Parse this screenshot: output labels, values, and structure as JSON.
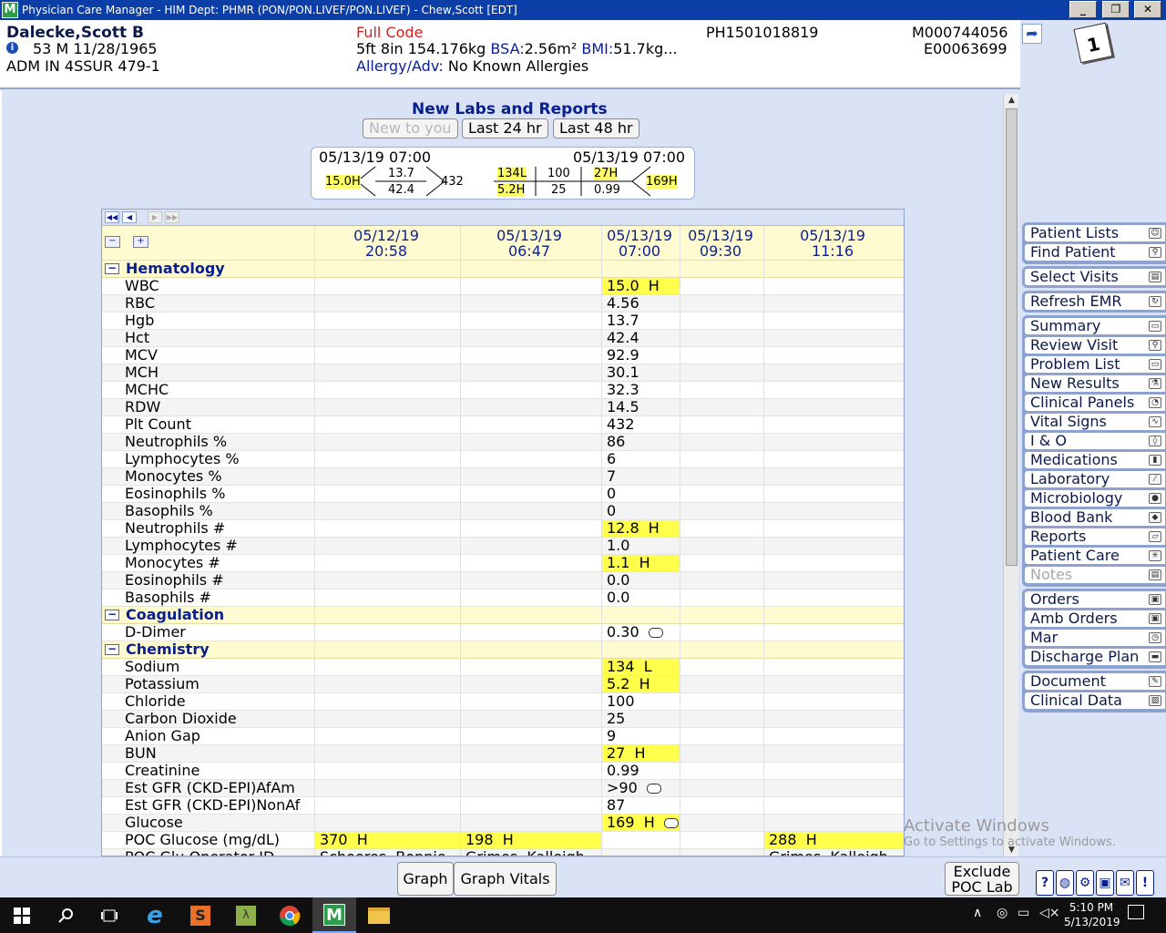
{
  "window": {
    "title": "Physician Care Manager - HIM Dept: PHMR (PON/PON.LIVEF/PON.LIVEF) - Chew,Scott [EDT]",
    "logo": "M",
    "minimize": "_",
    "restore": "❐",
    "close": "✕"
  },
  "patient": {
    "name": "Dalecke,Scott B",
    "age_sex_dob": "53  M  11/28/1965",
    "location": "ADM IN   4SSUR   479-1",
    "code_status": "Full Code",
    "measurements": "5ft 8in  154.176kg",
    "bsa_label": "BSA:",
    "bsa_value": "2.56m²",
    "bmi_label": "BMI:",
    "bmi_value": "51.7kg...",
    "allergy_label": "Allergy/Adv:",
    "allergy_value": "No Known Allergies",
    "account": "PH1501018819",
    "mrn": "M000744056",
    "encounter": "E00063699"
  },
  "sidebar": {
    "group1": [
      {
        "label": "Patient Lists",
        "icon": "people-icon"
      },
      {
        "label": "Find Patient",
        "icon": "search-people-icon"
      }
    ],
    "group2": [
      {
        "label": "Select Visits",
        "icon": "visits-icon"
      }
    ],
    "group3": [
      {
        "label": "Refresh EMR",
        "icon": "refresh-icon"
      }
    ],
    "group4": [
      {
        "label": "Summary",
        "icon": "folder-icon"
      },
      {
        "label": "Review Visit",
        "icon": "review-icon"
      },
      {
        "label": "Problem List",
        "icon": "folder-icon"
      },
      {
        "label": "New Results",
        "icon": "flask-icon"
      },
      {
        "label": "Clinical Panels",
        "icon": "panels-icon"
      },
      {
        "label": "Vital Signs",
        "icon": "pulse-icon"
      },
      {
        "label": "I & O",
        "icon": "drop-icon"
      },
      {
        "label": "Medications",
        "icon": "pill-bottle-icon"
      },
      {
        "label": "Laboratory",
        "icon": "test-tube-icon"
      },
      {
        "label": "Microbiology",
        "icon": "petri-dish-icon"
      },
      {
        "label": "Blood Bank",
        "icon": "blood-icon"
      },
      {
        "label": "Reports",
        "icon": "report-icon"
      },
      {
        "label": "Patient Care",
        "icon": "patient-care-icon"
      },
      {
        "label": "Notes",
        "icon": "notes-icon"
      }
    ],
    "group5": [
      {
        "label": "Orders",
        "icon": "orders-icon"
      },
      {
        "label": "Amb Orders",
        "icon": "amb-orders-icon"
      },
      {
        "label": "Mar",
        "icon": "mar-icon"
      },
      {
        "label": "Discharge Plan",
        "icon": "car-icon"
      }
    ],
    "group6": [
      {
        "label": "Document",
        "icon": "pen-icon"
      },
      {
        "label": "Clinical Data",
        "icon": "clinical-data-icon"
      }
    ]
  },
  "labs": {
    "title": "New Labs and Reports",
    "tabs": [
      "New to you",
      "Last 24 hr",
      "Last 48 hr"
    ],
    "fishbone": {
      "cbc_time": "05/13/19 07:00",
      "wbc": "15.0H",
      "hgb": "13.7",
      "hct": "42.4",
      "plt": "432",
      "bmp_time": "05/13/19 07:00",
      "na": "134L",
      "cl": "100",
      "bun": "27H",
      "k": "5.2H",
      "co2": "25",
      "cr": "0.99",
      "glu": "169H"
    },
    "columns": [
      {
        "date": "05/12/19",
        "time": "20:58"
      },
      {
        "date": "05/13/19",
        "time": "06:47"
      },
      {
        "date": "05/13/19",
        "time": "07:00"
      },
      {
        "date": "05/13/19",
        "time": "09:30"
      },
      {
        "date": "05/13/19",
        "time": "11:16"
      }
    ],
    "rows": [
      {
        "type": "section",
        "name": "Hematology",
        "toggle": "−"
      },
      {
        "name": "WBC",
        "vals": [
          "",
          "",
          "15.0  H",
          "",
          ""
        ],
        "hi": [
          2
        ]
      },
      {
        "name": "RBC",
        "vals": [
          "",
          "",
          "4.56",
          "",
          ""
        ]
      },
      {
        "name": "Hgb",
        "vals": [
          "",
          "",
          "13.7",
          "",
          ""
        ]
      },
      {
        "name": "Hct",
        "vals": [
          "",
          "",
          "42.4",
          "",
          ""
        ]
      },
      {
        "name": "MCV",
        "vals": [
          "",
          "",
          "92.9",
          "",
          ""
        ]
      },
      {
        "name": "MCH",
        "vals": [
          "",
          "",
          "30.1",
          "",
          ""
        ]
      },
      {
        "name": "MCHC",
        "vals": [
          "",
          "",
          "32.3",
          "",
          ""
        ]
      },
      {
        "name": "RDW",
        "vals": [
          "",
          "",
          "14.5",
          "",
          ""
        ]
      },
      {
        "name": "Plt Count",
        "vals": [
          "",
          "",
          "432",
          "",
          ""
        ]
      },
      {
        "name": "Neutrophils %",
        "vals": [
          "",
          "",
          "86",
          "",
          ""
        ]
      },
      {
        "name": "Lymphocytes %",
        "vals": [
          "",
          "",
          "6",
          "",
          ""
        ]
      },
      {
        "name": "Monocytes %",
        "vals": [
          "",
          "",
          "7",
          "",
          ""
        ]
      },
      {
        "name": "Eosinophils %",
        "vals": [
          "",
          "",
          "0",
          "",
          ""
        ]
      },
      {
        "name": "Basophils %",
        "vals": [
          "",
          "",
          "0",
          "",
          ""
        ]
      },
      {
        "name": "Neutrophils #",
        "vals": [
          "",
          "",
          "12.8  H",
          "",
          ""
        ],
        "hi": [
          2
        ]
      },
      {
        "name": "Lymphocytes #",
        "vals": [
          "",
          "",
          "1.0",
          "",
          ""
        ]
      },
      {
        "name": "Monocytes #",
        "vals": [
          "",
          "",
          "1.1  H",
          "",
          ""
        ],
        "hi": [
          2
        ]
      },
      {
        "name": "Eosinophils #",
        "vals": [
          "",
          "",
          "0.0",
          "",
          ""
        ]
      },
      {
        "name": "Basophils #",
        "vals": [
          "",
          "",
          "0.0",
          "",
          ""
        ]
      },
      {
        "type": "section",
        "name": "Coagulation",
        "toggle": "−"
      },
      {
        "name": "D-Dimer",
        "vals": [
          "",
          "",
          "0.30",
          "",
          ""
        ],
        "cmt": [
          2
        ]
      },
      {
        "type": "section",
        "name": "Chemistry",
        "toggle": "−"
      },
      {
        "name": "Sodium",
        "vals": [
          "",
          "",
          "134  L",
          "",
          ""
        ],
        "hi": [
          2
        ]
      },
      {
        "name": "Potassium",
        "vals": [
          "",
          "",
          "5.2  H",
          "",
          ""
        ],
        "hi": [
          2
        ]
      },
      {
        "name": "Chloride",
        "vals": [
          "",
          "",
          "100",
          "",
          ""
        ]
      },
      {
        "name": "Carbon Dioxide",
        "vals": [
          "",
          "",
          "25",
          "",
          ""
        ]
      },
      {
        "name": "Anion Gap",
        "vals": [
          "",
          "",
          "9",
          "",
          ""
        ]
      },
      {
        "name": "BUN",
        "vals": [
          "",
          "",
          "27  H",
          "",
          ""
        ],
        "hi": [
          2
        ]
      },
      {
        "name": "Creatinine",
        "vals": [
          "",
          "",
          "0.99",
          "",
          ""
        ]
      },
      {
        "name": "Est GFR (CKD-EPI)AfAm",
        "vals": [
          "",
          "",
          ">90",
          "",
          ""
        ],
        "cmt": [
          2
        ]
      },
      {
        "name": "Est GFR (CKD-EPI)NonAf",
        "vals": [
          "",
          "",
          "87",
          "",
          ""
        ]
      },
      {
        "name": "Glucose",
        "vals": [
          "",
          "",
          "169  H",
          "",
          ""
        ],
        "hi": [
          2
        ],
        "cmt": [
          2
        ]
      },
      {
        "name": "POC Glucose (mg/dL)",
        "vals": [
          "370  H",
          "198  H",
          "",
          "",
          "288  H"
        ],
        "hi": [
          0,
          1,
          4
        ]
      },
      {
        "name": "POC Glu Operator ID",
        "vals": [
          "Schoeres, Bonnie",
          "Grimes, Kalleigh",
          "",
          "",
          "Grimes, Kalleigh"
        ]
      }
    ]
  },
  "bottom": {
    "graph": "Graph",
    "graph_vitals": "Graph Vitals",
    "exclude_line1": "Exclude",
    "exclude_line2": "POC Lab",
    "help": "?",
    "alert": "!"
  },
  "watermark": {
    "line1": "Activate Windows",
    "line2": "Go to Settings to activate Windows."
  },
  "taskbar": {
    "time": "5:10 PM",
    "date": "5/13/2019"
  }
}
